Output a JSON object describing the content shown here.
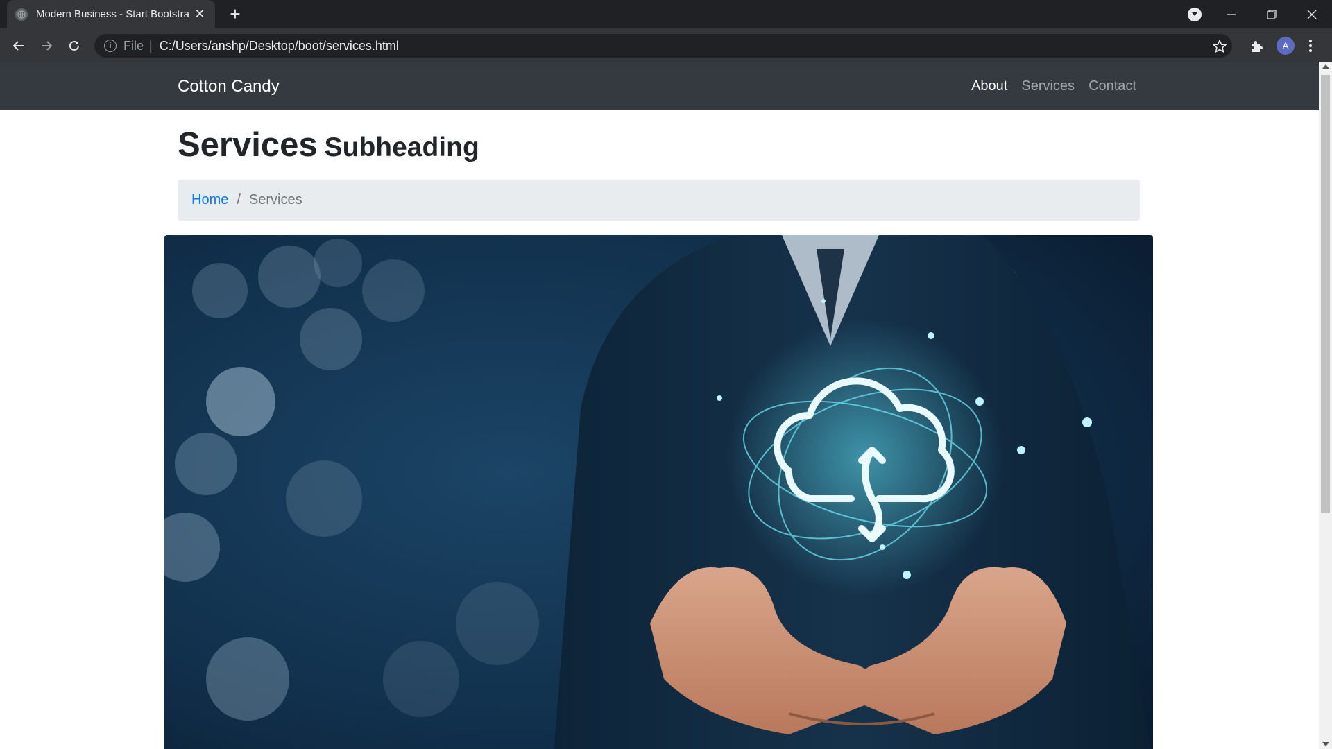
{
  "browser": {
    "tab_title": "Modern Business - Start Bootstra",
    "address": {
      "scheme_label": "File",
      "separator": "|",
      "url": "C:/Users/anshp/Desktop/boot/services.html"
    },
    "profile_initial": "A"
  },
  "site": {
    "brand": "Cotton Candy",
    "nav": [
      {
        "label": "About",
        "active": true
      },
      {
        "label": "Services",
        "active": false
      },
      {
        "label": "Contact",
        "active": false
      }
    ]
  },
  "page": {
    "title": "Services",
    "subtitle": "Subheading",
    "breadcrumb": {
      "home": "Home",
      "separator": "/",
      "current": "Services"
    }
  },
  "hero_image": {
    "icon": "cloud-sync-icon",
    "colors": {
      "background": "#0f2c45",
      "glow": "#3fd0ea"
    }
  }
}
